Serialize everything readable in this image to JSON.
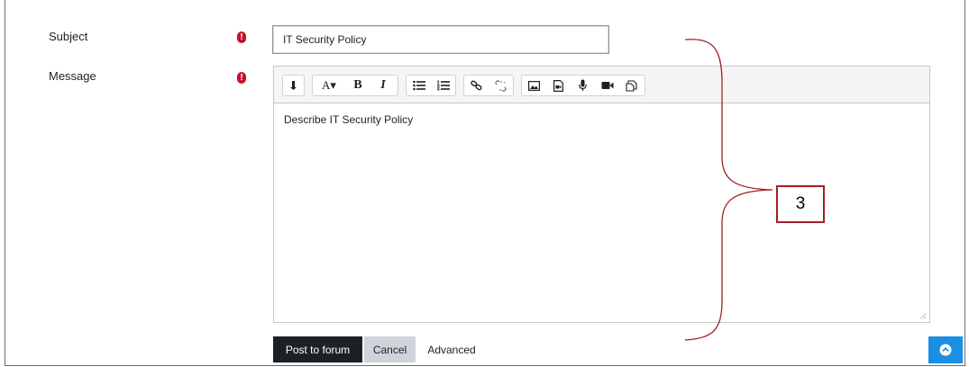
{
  "form": {
    "subject_label": "Subject",
    "message_label": "Message",
    "required_marker": "!",
    "subject_value": "IT Security Policy",
    "message_text": "Describe IT Security Policy"
  },
  "toolbar": {
    "show_more_icon": "expand-down-icon",
    "font_button": "A▾",
    "bold_button": "B",
    "italic_button": "I"
  },
  "actions": {
    "post_label": "Post to forum",
    "cancel_label": "Cancel",
    "advanced_label": "Advanced"
  },
  "annotation": {
    "callout_number": "3",
    "callout_color": "#a31f24"
  },
  "colors": {
    "primary_button": "#1d2125",
    "secondary_button": "#ced4da",
    "required_icon": "#c8102e",
    "scroll_top_button": "#1a8fe3"
  }
}
